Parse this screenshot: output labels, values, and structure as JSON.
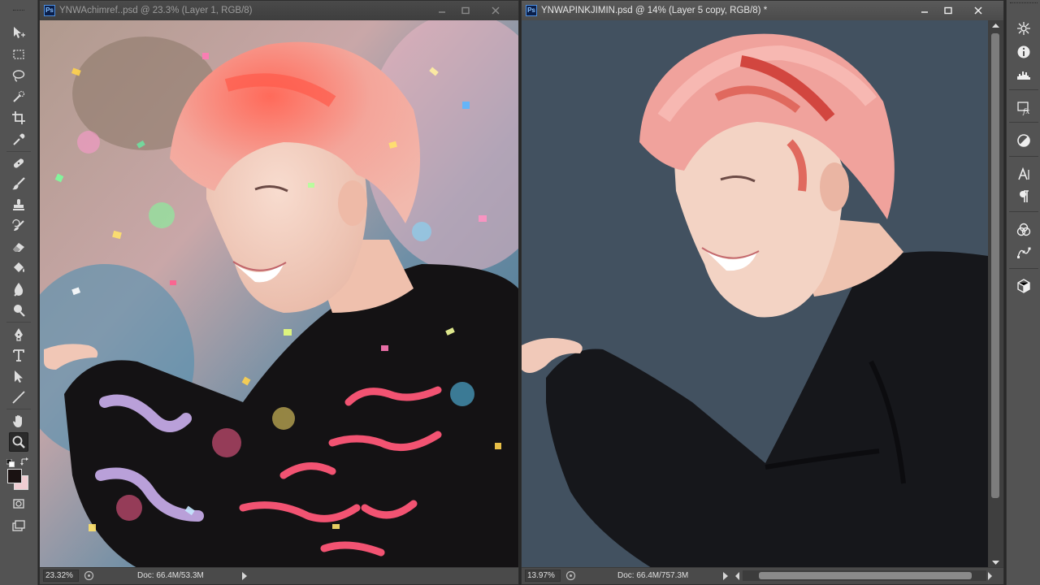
{
  "colors": {
    "chrome": "#535353",
    "canvas_bg_right": "#425160",
    "foreground_color": "#1a1212",
    "background_color": "#f0cdd2"
  },
  "toolbar": {
    "tools": [
      {
        "id": "move",
        "icon": "move-tool-icon"
      },
      {
        "id": "marquee",
        "icon": "rectangular-marquee-icon"
      },
      {
        "id": "lasso",
        "icon": "lasso-icon"
      },
      {
        "id": "quick-select",
        "icon": "quick-selection-icon"
      },
      {
        "id": "crop",
        "icon": "crop-icon"
      },
      {
        "id": "eyedropper",
        "icon": "eyedropper-icon"
      },
      {
        "id": "healing",
        "icon": "healing-brush-icon"
      },
      {
        "id": "brush",
        "icon": "brush-icon"
      },
      {
        "id": "stamp",
        "icon": "clone-stamp-icon"
      },
      {
        "id": "history-brush",
        "icon": "history-brush-icon"
      },
      {
        "id": "eraser",
        "icon": "eraser-icon"
      },
      {
        "id": "paint-bucket",
        "icon": "paint-bucket-icon"
      },
      {
        "id": "blur",
        "icon": "blur-icon"
      },
      {
        "id": "dodge",
        "icon": "dodge-icon"
      },
      {
        "id": "pen",
        "icon": "pen-icon"
      },
      {
        "id": "type",
        "icon": "type-icon"
      },
      {
        "id": "path-select",
        "icon": "path-selection-icon"
      },
      {
        "id": "line",
        "icon": "line-icon"
      },
      {
        "id": "hand",
        "icon": "hand-icon"
      },
      {
        "id": "zoom",
        "icon": "zoom-icon",
        "active": true
      }
    ]
  },
  "windows": {
    "left": {
      "badge": "Ps",
      "title": "YNWAchimref..psd @ 23.3% (Layer 1, RGB/8)",
      "zoom": "23.32%",
      "doc": "Doc: 66.4M/53.3M"
    },
    "right": {
      "badge": "Ps",
      "title": "YNWAPINKJIMIN.psd @ 14% (Layer 5 copy, RGB/8) *",
      "zoom": "13.97%",
      "doc": "Doc: 66.4M/757.3M"
    }
  },
  "panels": [
    "navigator-icon",
    "info-icon",
    "histogram-icon",
    "styles-icon",
    "adjustments-icon",
    "character-icon",
    "paragraph-icon",
    "channels-icon",
    "paths-icon",
    "3d-icon"
  ]
}
